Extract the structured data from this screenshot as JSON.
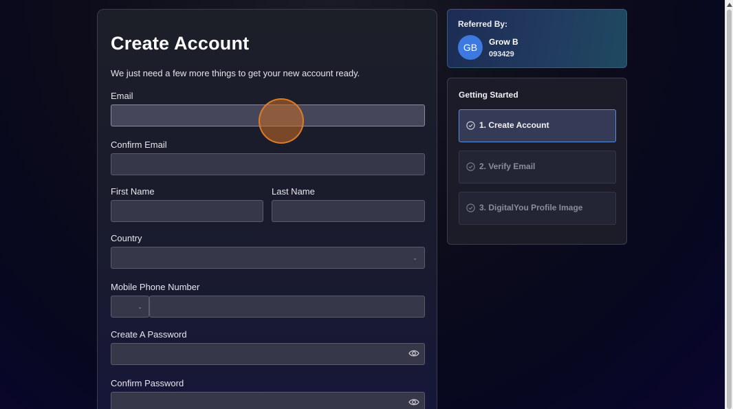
{
  "form": {
    "title": "Create Account",
    "subtitle": "We just need a few more things to get your new account ready.",
    "email_label": "Email",
    "confirm_email_label": "Confirm Email",
    "first_name_label": "First Name",
    "last_name_label": "Last Name",
    "country_label": "Country",
    "mobile_label": "Mobile Phone Number",
    "password_label": "Create A Password",
    "confirm_password_label": "Confirm Password"
  },
  "referral": {
    "title": "Referred By:",
    "initials": "GB",
    "name": "Grow B",
    "code": "093429"
  },
  "getting_started": {
    "title": "Getting Started",
    "steps": [
      {
        "label": "1. Create Account"
      },
      {
        "label": "2. Verify Email"
      },
      {
        "label": "3. DigitalYou Profile Image"
      }
    ]
  },
  "colors": {
    "accent": "#5a8fd8",
    "avatar": "#3d7ae0",
    "click_indicator": "#e08228"
  },
  "icons": [
    "check-circle-icon",
    "eye-icon",
    "chevron-down-icon"
  ]
}
